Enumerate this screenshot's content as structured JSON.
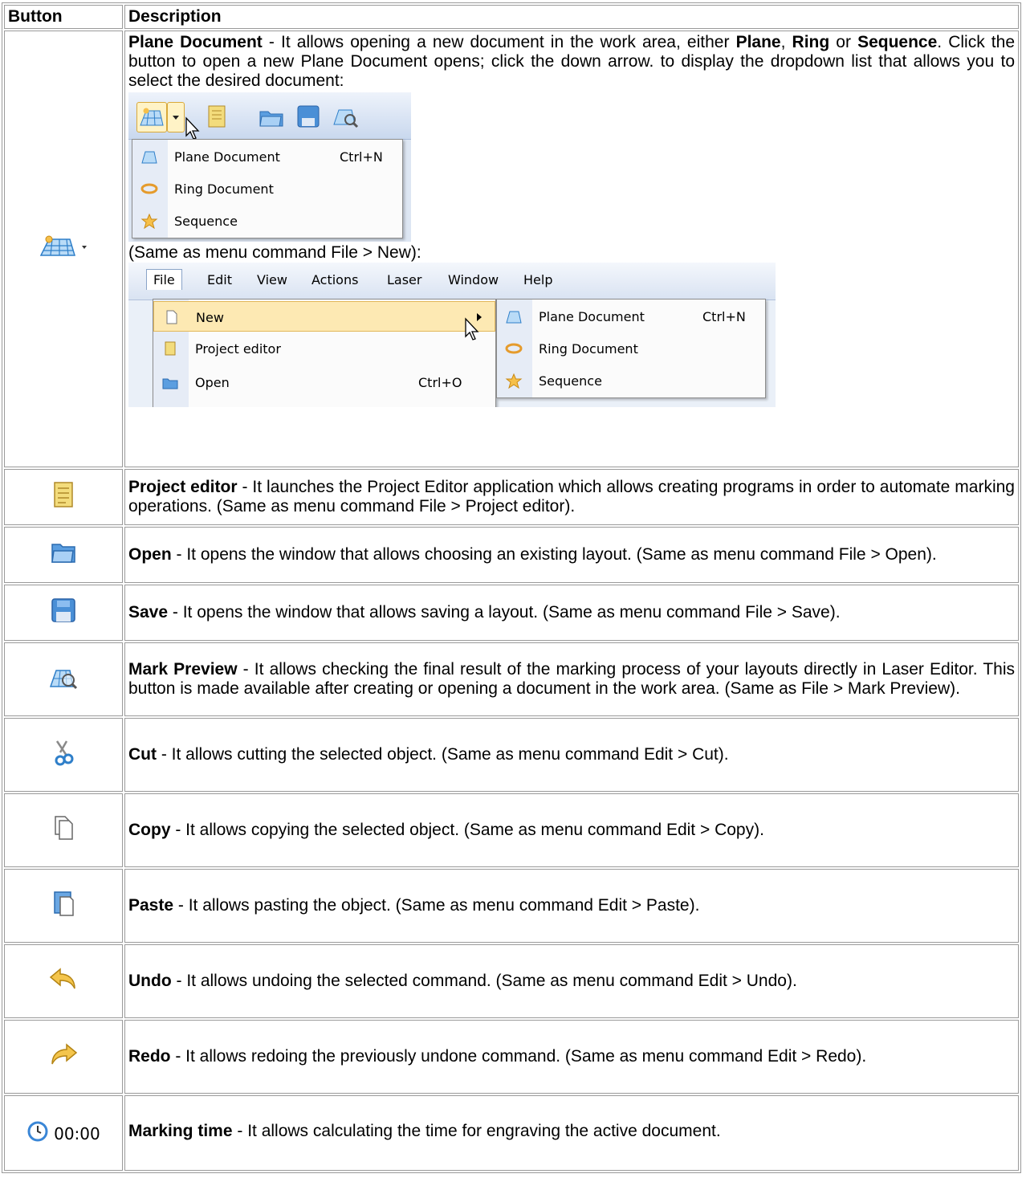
{
  "headers": {
    "button": "Button",
    "description": "Description"
  },
  "rows": [
    {
      "icon": "plane-document-dropdown-icon",
      "label": "Plane Document",
      "text_pre": " - It allows opening a new document in the work area, either ",
      "b1": "Plane",
      "sep1": ", ",
      "b2": "Ring",
      "sep2": " or ",
      "b3": "Sequence",
      "text_post": ". Click the button to open a new Plane Document opens; click the down arrow. to display the dropdown list that allows you to select the desired document:",
      "dropdown": {
        "items": [
          {
            "icon": "plane-doc-icon",
            "text": "Plane Document",
            "shortcut": "Ctrl+N"
          },
          {
            "icon": "ring-doc-icon",
            "text": "Ring Document",
            "shortcut": ""
          },
          {
            "icon": "sequence-icon",
            "text": "Sequence",
            "shortcut": ""
          }
        ]
      },
      "caption": "(Same as menu command File > New):",
      "menubar": [
        "File",
        "Edit",
        "View",
        "Actions",
        "Laser",
        "Window",
        "Help"
      ],
      "file_menu": [
        {
          "text": "New",
          "shortcut": ""
        },
        {
          "text": "Project editor",
          "shortcut": ""
        },
        {
          "text": "Open",
          "shortcut": "Ctrl+O"
        }
      ],
      "new_submenu": [
        {
          "text": "Plane Document",
          "shortcut": "Ctrl+N"
        },
        {
          "text": "Ring Document",
          "shortcut": ""
        },
        {
          "text": "Sequence",
          "shortcut": ""
        }
      ]
    },
    {
      "icon": "project-editor-icon",
      "label": "Project editor",
      "text": " - It launches the Project Editor application which allows creating programs in order to automate marking operations. (Same as menu command File > Project editor)."
    },
    {
      "icon": "open-folder-icon",
      "label": "Open",
      "text": " - It opens the window that allows choosing an existing layout. (Same as menu command File > Open)."
    },
    {
      "icon": "save-disk-icon",
      "label": "Save",
      "text": " - It opens the window that allows saving a layout. (Same as menu command File > Save)."
    },
    {
      "icon": "mark-preview-icon",
      "label": "Mark Preview",
      "text": " - It allows checking the final result of the marking process of your layouts directly in Laser Editor. This button is made available after creating or opening a document in the work area. (Same as File > Mark Preview)."
    },
    {
      "icon": "scissors-icon",
      "label": "Cut",
      "text": " - It allows cutting the selected object. (Same as menu command Edit > Cut)."
    },
    {
      "icon": "copy-icon",
      "label": "Copy",
      "text": " - It allows copying the selected object. (Same as menu command Edit > Copy)."
    },
    {
      "icon": "paste-icon",
      "label": "Paste",
      "text": " - It allows pasting the object. (Same as menu command Edit > Paste)."
    },
    {
      "icon": "undo-arrow-icon",
      "label": "Undo",
      "text": " - It allows undoing the selected command. (Same as menu command Edit > Undo)."
    },
    {
      "icon": "redo-arrow-icon",
      "label": "Redo",
      "text": " - It allows redoing the previously undone command. (Same as menu command Edit > Redo)."
    },
    {
      "icon": "clock-icon",
      "button_text": "00:00",
      "label": "Marking time",
      "text": " - It allows calculating the time for engraving the active document."
    }
  ]
}
